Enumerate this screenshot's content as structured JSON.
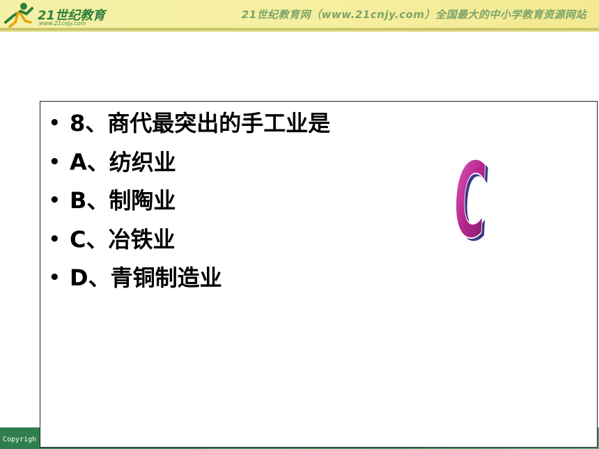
{
  "header": {
    "logo_text": "21世纪教育",
    "logo_url": "www.21cnjy.com",
    "site_banner": "21世纪教育网（www.21cnjy.com）全国最大的中小学教育资源网站"
  },
  "question": {
    "items": [
      "8、商代最突出的手工业是",
      "A、纺织业",
      "B、制陶业",
      "C、冶铁业",
      "D、青铜制造业"
    ],
    "bullet": "•",
    "answer": "C"
  },
  "footer": {
    "copyright": "Copyrigh"
  },
  "colors": {
    "header_bg": "#f5f0a8",
    "footer_bg": "#2e7d4d",
    "answer_fill": "#b8268e",
    "answer_shadow": "#3a3a8a"
  }
}
